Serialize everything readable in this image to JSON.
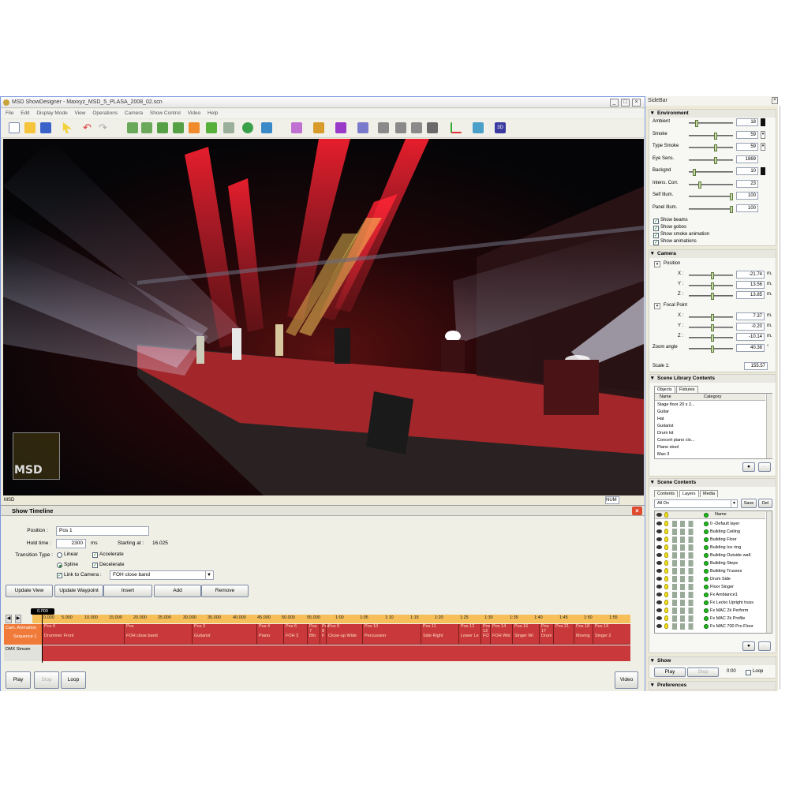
{
  "window": {
    "title": "MSD ShowDesigner - Maxxyz_MSD_5_PLASA_2008_02.scn"
  },
  "menu": [
    "File",
    "Edit",
    "Display Mode",
    "View",
    "Operations",
    "Camera",
    "Show Control",
    "Video",
    "Help"
  ],
  "status": {
    "left": "MSD",
    "right": "NUM"
  },
  "viewport": {
    "logo_text": "MSD"
  },
  "timeline": {
    "header": "Show Timeline",
    "position_label": "Position :",
    "position_value": "Pos 1",
    "hold_label": "Hold time :",
    "hold_value": "2300",
    "hold_unit": "ms",
    "starting_label": "Starting at :",
    "starting_value": "16.025",
    "transition_label": "Transition Type :",
    "linear": "Linear",
    "spline": "Spline",
    "accelerate": "Accelerate",
    "decelerate": "Decelerate",
    "link_camera": "Link to Camera :",
    "camera_value": "FOH close band",
    "buttons": {
      "update_view": "Update View",
      "update_waypoint": "Update Waypoint",
      "insert": "Insert",
      "add": "Add",
      "remove": "Remove"
    },
    "current_time": "0.000",
    "ruler": [
      "0.000",
      "5.000",
      "10.000",
      "15.000",
      "20.000",
      "25.000",
      "30.000",
      "35.000",
      "40.000",
      "45.000",
      "50.000",
      "55.000",
      "1:00",
      "1:05",
      "1:10",
      "1:15",
      "1:20",
      "1:25",
      "1:30",
      "1:35",
      "1:40",
      "1:45",
      "1:50",
      "1:55"
    ],
    "track_a_label": "Cam. Animation",
    "track_a_sub": "Sequence 1",
    "track_b_label": "DMX Stream",
    "segments": [
      {
        "pos": "Pos 0",
        "name": "Drummer Front"
      },
      {
        "pos": "Pos",
        "name": "FOH close band"
      },
      {
        "pos": "Pos 3",
        "name": "Guitarist"
      },
      {
        "pos": "Pos 4",
        "name": "Piano"
      },
      {
        "pos": "Pos 6",
        "name": "FOH 3"
      },
      {
        "pos": "Pos 7",
        "name": "Bfo"
      },
      {
        "pos": "Pos 8",
        "name": "F"
      },
      {
        "pos": "Pos 9",
        "name": "Close-up Wide"
      },
      {
        "pos": "Pos 10",
        "name": "Percussion"
      },
      {
        "pos": "Pos 11",
        "name": "Side Right"
      },
      {
        "pos": "Pos 12",
        "name": "Lower Le"
      },
      {
        "pos": "Pos 13",
        "name": "FO"
      },
      {
        "pos": "Pos 14",
        "name": "FOH Wid"
      },
      {
        "pos": "Pos 16",
        "name": "Singer Wi"
      },
      {
        "pos": "Pos 17",
        "name": "Drum"
      },
      {
        "pos": "Pos 21",
        "name": ""
      },
      {
        "pos": "Pos 18",
        "name": "Moving"
      },
      {
        "pos": "Pos 19",
        "name": "Singer 2"
      }
    ],
    "play": "Play",
    "stop": "Stop",
    "loop": "Loop",
    "video": "Video"
  },
  "sidebar": {
    "title": "SideBar",
    "environment": {
      "header": "Environment",
      "rows": [
        {
          "label": "Ambient",
          "value": "18"
        },
        {
          "label": "Smoke",
          "value": "59"
        },
        {
          "label": "Type Smoke",
          "value": "59"
        },
        {
          "label": "Eye Sens.",
          "value": "1869"
        },
        {
          "label": "Backgnd",
          "value": "10"
        },
        {
          "label": "Intens. Corr.",
          "value": "23"
        },
        {
          "label": "Self Illum.",
          "value": "100"
        },
        {
          "label": "Panel Illum.",
          "value": "100"
        }
      ],
      "checks": [
        "Show beams",
        "Show gobos",
        "Show smoke animation",
        "Show animations"
      ]
    },
    "camera": {
      "header": "Camera",
      "position": "Position",
      "focal": "Focal Point",
      "pos": [
        {
          "axis": "X :",
          "value": "-21.74",
          "unit": "m."
        },
        {
          "axis": "Y :",
          "value": "13.56",
          "unit": "m."
        },
        {
          "axis": "Z :",
          "value": "13.85",
          "unit": "m."
        }
      ],
      "foc": [
        {
          "axis": "X :",
          "value": "7.37",
          "unit": "m."
        },
        {
          "axis": "Y :",
          "value": "-0.20",
          "unit": "m."
        },
        {
          "axis": "Z :",
          "value": "-10.14",
          "unit": "m."
        }
      ],
      "zoom_label": "Zoom angle",
      "zoom_value": "40.38",
      "zoom_unit": "°",
      "scale_label": "Scale 1:",
      "scale_value": "155.57"
    },
    "library": {
      "header": "Scene Library Contents",
      "tabs": [
        "Objects",
        "Fixtures"
      ],
      "col_name": "Name",
      "col_cat": "Category",
      "items": [
        "Stage floor 20 x 2...",
        "Guitar",
        "Hat",
        "Guitarist",
        "Drum kit",
        "Concert piano clo...",
        "Piano stool",
        "Man 3"
      ]
    },
    "contents": {
      "header": "Scene Contents",
      "tabs": [
        "Contents",
        "Layers",
        "Media"
      ],
      "filter": "All On",
      "save": "Save",
      "del": "Del",
      "col_name": "Name",
      "layers": [
        "0 -Default layer",
        "Building Ceiling",
        "Building Floor",
        "Building Ice ring",
        "Building Outside wall",
        "Building Steps",
        "Building Trusses",
        "Drum Side",
        "Floor Singer",
        "Fx Ambiance1",
        "Fx Lecko Upright truss",
        "Fx MAC 2k Perform",
        "Fx MAC 2k Profile",
        "Fx MAC 700 Pro Floor"
      ]
    },
    "show": {
      "header": "Show",
      "play": "Play",
      "stop": "Stop",
      "time": "0:00",
      "loop": "Loop"
    },
    "preferences": {
      "header": "Preferences"
    }
  }
}
